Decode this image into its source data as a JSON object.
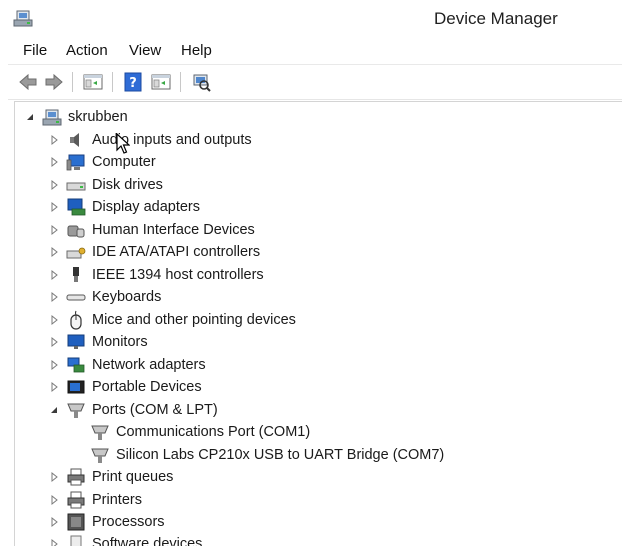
{
  "window": {
    "title": "Device Manager"
  },
  "menu": {
    "items": [
      "File",
      "Action",
      "View",
      "Help"
    ]
  },
  "toolbar": {
    "buttons": [
      "back-icon",
      "forward-icon",
      "properties-view-icon",
      "help-icon",
      "show-hidden-icon",
      "scan-hardware-icon"
    ]
  },
  "tree": {
    "root": "skrubben",
    "categories": [
      {
        "label": "Audio inputs and outputs",
        "icon": "speaker-icon",
        "expanded": false
      },
      {
        "label": "Computer",
        "icon": "computer-icon",
        "expanded": false
      },
      {
        "label": "Disk drives",
        "icon": "disk-drive-icon",
        "expanded": false
      },
      {
        "label": "Display adapters",
        "icon": "display-adapter-icon",
        "expanded": false
      },
      {
        "label": "Human Interface Devices",
        "icon": "hid-icon",
        "expanded": false
      },
      {
        "label": "IDE ATA/ATAPI controllers",
        "icon": "ide-controller-icon",
        "expanded": false
      },
      {
        "label": "IEEE 1394 host controllers",
        "icon": "firewire-icon",
        "expanded": false
      },
      {
        "label": "Keyboards",
        "icon": "keyboard-icon",
        "expanded": false
      },
      {
        "label": "Mice and other pointing devices",
        "icon": "mouse-icon",
        "expanded": false
      },
      {
        "label": "Monitors",
        "icon": "monitor-icon",
        "expanded": false
      },
      {
        "label": "Network adapters",
        "icon": "network-adapter-icon",
        "expanded": false
      },
      {
        "label": "Portable Devices",
        "icon": "portable-device-icon",
        "expanded": false
      },
      {
        "label": "Ports (COM & LPT)",
        "icon": "port-icon",
        "expanded": true,
        "children": [
          {
            "label": "Communications Port (COM1)",
            "icon": "port-icon"
          },
          {
            "label": "Silicon Labs CP210x USB to UART Bridge (COM7)",
            "icon": "port-icon"
          }
        ]
      },
      {
        "label": "Print queues",
        "icon": "printer-icon",
        "expanded": false
      },
      {
        "label": "Printers",
        "icon": "printer-icon",
        "expanded": false
      },
      {
        "label": "Processors",
        "icon": "processor-icon",
        "expanded": false
      },
      {
        "label": "Software devices",
        "icon": "software-device-icon",
        "expanded": false
      }
    ]
  }
}
